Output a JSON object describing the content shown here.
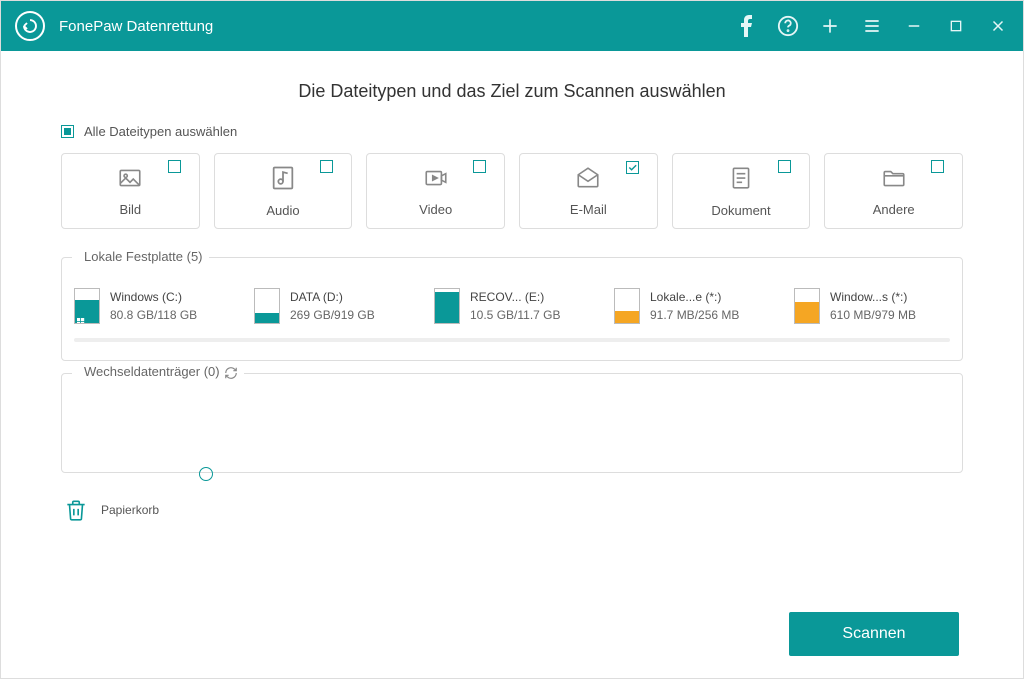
{
  "app": {
    "title": "FonePaw Datenrettung"
  },
  "heading": "Die Dateitypen und das Ziel zum Scannen auswählen",
  "selectAll": {
    "label": "Alle Dateitypen auswählen",
    "state": "partial"
  },
  "types": [
    {
      "label": "Bild",
      "checked": false,
      "icon": "image"
    },
    {
      "label": "Audio",
      "checked": false,
      "icon": "audio"
    },
    {
      "label": "Video",
      "checked": false,
      "icon": "video"
    },
    {
      "label": "E-Mail",
      "checked": true,
      "icon": "mail"
    },
    {
      "label": "Dokument",
      "checked": false,
      "icon": "document"
    },
    {
      "label": "Andere",
      "checked": false,
      "icon": "folder"
    }
  ],
  "localSection": {
    "label": "Lokale Festplatte (5)",
    "drives": [
      {
        "name": "Windows (C:)",
        "size": "80.8 GB/118 GB",
        "fillPct": 68,
        "color": "teal",
        "selected": true,
        "win": true
      },
      {
        "name": "DATA (D:)",
        "size": "269 GB/919 GB",
        "fillPct": 29,
        "color": "teal",
        "selected": false,
        "win": false
      },
      {
        "name": "RECOV... (E:)",
        "size": "10.5 GB/11.7 GB",
        "fillPct": 90,
        "color": "teal",
        "selected": false,
        "win": false
      },
      {
        "name": "Lokale...e (*:)",
        "size": "91.7 MB/256 MB",
        "fillPct": 36,
        "color": "orange",
        "selected": false,
        "win": false
      },
      {
        "name": "Window...s (*:)",
        "size": "610 MB/979 MB",
        "fillPct": 62,
        "color": "orange",
        "selected": false,
        "win": false
      }
    ]
  },
  "removableSection": {
    "label": "Wechseldatenträger (0)"
  },
  "recycle": {
    "label": "Papierkorb"
  },
  "scanButton": "Scannen"
}
